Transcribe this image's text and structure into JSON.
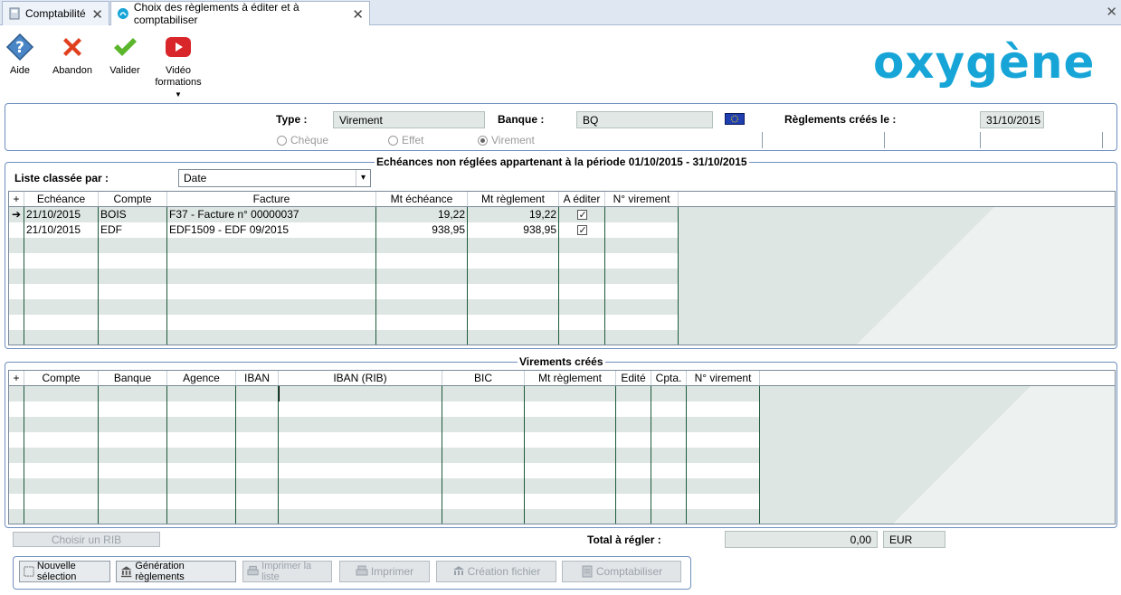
{
  "tabs": [
    {
      "label": "Comptabilité"
    },
    {
      "label": "Choix des règlements à éditer et à comptabiliser"
    }
  ],
  "toolbar": {
    "aide": "Aide",
    "abandon": "Abandon",
    "valider": "Valider",
    "video": "Vidéo formations"
  },
  "logo": "oxygène",
  "header": {
    "type_label": "Type :",
    "type_value": "Virement",
    "banque_label": "Banque :",
    "banque_value": "BQ",
    "reglements_label": "Règlements créés le :",
    "reglements_value": "31/10/2015",
    "radios": [
      {
        "label": "Chèque",
        "checked": false
      },
      {
        "label": "Effet",
        "checked": false
      },
      {
        "label": "Virement",
        "checked": true
      }
    ]
  },
  "echeances": {
    "title": "Echéances non réglées appartenant à la période 01/10/2015 - 31/10/2015",
    "sort_label": "Liste classée par :",
    "sort_value": "Date",
    "columns": [
      "Echéance",
      "Compte",
      "Facture",
      "Mt échéance",
      "Mt règlement",
      "A éditer",
      "N° virement"
    ],
    "rows": [
      {
        "echeance": "21/10/2015",
        "compte": "BOIS",
        "facture": "F37 - Facture n° 00000037",
        "mt_echeance": "19,22",
        "mt_reglement": "19,22",
        "a_editer": true,
        "num_virement": ""
      },
      {
        "echeance": "21/10/2015",
        "compte": "EDF",
        "facture": "EDF1509 - EDF 09/2015",
        "mt_echeance": "938,95",
        "mt_reglement": "938,95",
        "a_editer": true,
        "num_virement": ""
      }
    ]
  },
  "virements": {
    "title": "Virements créés",
    "columns": [
      "Compte",
      "Banque",
      "Agence",
      "IBAN",
      "IBAN (RIB)",
      "BIC",
      "Mt règlement",
      "Edité",
      "Cpta.",
      "N° virement"
    ]
  },
  "footer": {
    "choisir_rib": "Choisir un RIB",
    "total_label": "Total à régler :",
    "total_value": "0,00",
    "currency": "EUR",
    "buttons": {
      "nouvelle": "Nouvelle sélection",
      "generation": "Génération règlements",
      "imprimer_liste": "Imprimer la liste",
      "imprimer": "Imprimer",
      "creation": "Création fichier",
      "comptabiliser": "Comptabiliser"
    }
  },
  "colors": {
    "accent": "#17a5d8",
    "grid_alt": "#dde6e3",
    "panel_border": "#6f8fbf"
  }
}
